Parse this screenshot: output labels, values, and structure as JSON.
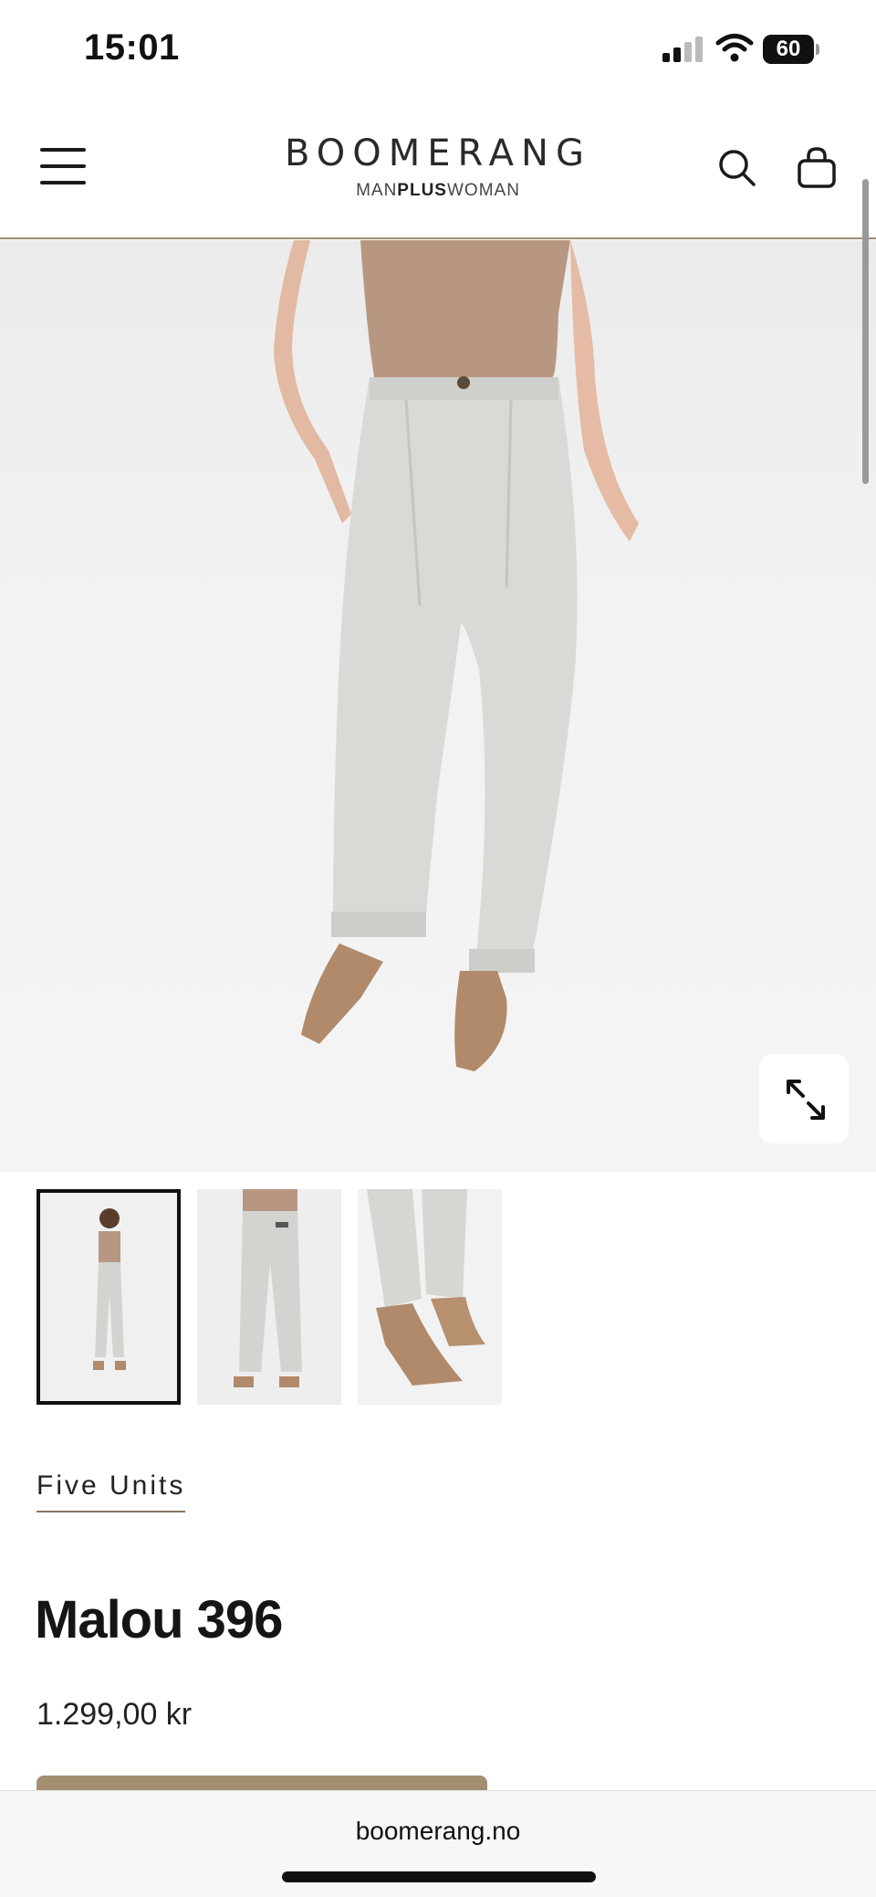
{
  "status_bar": {
    "time": "15:01",
    "battery": "60"
  },
  "header": {
    "logo_main": "BOOMERANG",
    "logo_sub_left": "MAN",
    "logo_sub_bold": "PLUS",
    "logo_sub_right": "WOMAN"
  },
  "gallery": {
    "thumbnails": [
      {
        "label": "front view",
        "selected": true
      },
      {
        "label": "back view",
        "selected": false
      },
      {
        "label": "shoe detail",
        "selected": false
      }
    ]
  },
  "product": {
    "brand": "Five Units",
    "name": "Malou 396",
    "price": "1.299,00 kr"
  },
  "browser": {
    "url": "boomerang.no"
  },
  "colors": {
    "accent": "#a48e72",
    "header_border": "#a08a70"
  },
  "icons": [
    "menu-icon",
    "search-icon",
    "cart-icon",
    "expand-icon",
    "signal-icon",
    "wifi-icon",
    "battery-icon"
  ]
}
